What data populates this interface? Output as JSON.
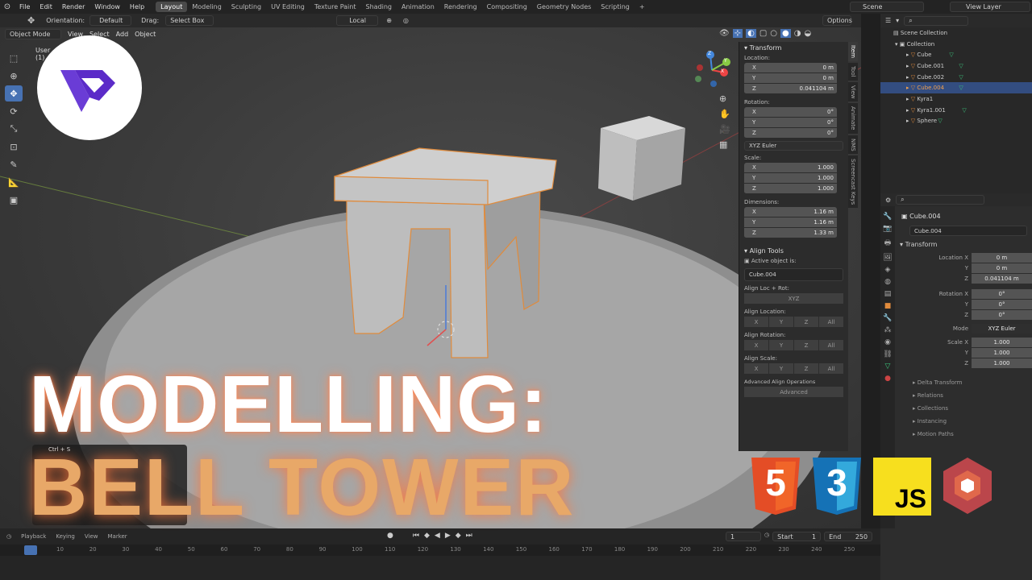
{
  "topbar": {
    "menus": [
      "File",
      "Edit",
      "Render",
      "Window",
      "Help"
    ],
    "workspaces": [
      "Layout",
      "Modeling",
      "Sculpting",
      "UV Editing",
      "Texture Paint",
      "Shading",
      "Animation",
      "Rendering",
      "Compositing",
      "Geometry Nodes",
      "Scripting"
    ],
    "active_workspace": "Layout",
    "add_tab": "+",
    "scene": "Scene",
    "view_layer": "View Layer"
  },
  "tool_header": {
    "orientation_label": "Orientation:",
    "orientation_value": "Default",
    "drag_label": "Drag:",
    "drag_value": "Select Box",
    "transform_space": "Local",
    "options": "Options"
  },
  "viewport_header": {
    "mode": "Object Mode",
    "menus": [
      "View",
      "Select",
      "Add",
      "Object"
    ],
    "overlay_text_1": "User",
    "overlay_text_2": "(1)"
  },
  "gizmo": {
    "x": "X",
    "y": "Y",
    "z": "Z"
  },
  "npanel": {
    "transform_title": "Transform",
    "location_label": "Location:",
    "location": [
      {
        "axis": "X",
        "value": "0 m"
      },
      {
        "axis": "Y",
        "value": "0 m"
      },
      {
        "axis": "Z",
        "value": "0.041104 m"
      }
    ],
    "rotation_label": "Rotation:",
    "rotation": [
      {
        "axis": "X",
        "value": "0°"
      },
      {
        "axis": "Y",
        "value": "0°"
      },
      {
        "axis": "Z",
        "value": "0°"
      }
    ],
    "rotation_mode": "XYZ Euler",
    "scale_label": "Scale:",
    "scale": [
      {
        "axis": "X",
        "value": "1.000"
      },
      {
        "axis": "Y",
        "value": "1.000"
      },
      {
        "axis": "Z",
        "value": "1.000"
      }
    ],
    "dimensions_label": "Dimensions:",
    "dimensions": [
      {
        "axis": "X",
        "value": "1.16 m"
      },
      {
        "axis": "Y",
        "value": "1.16 m"
      },
      {
        "axis": "Z",
        "value": "1.33 m"
      }
    ],
    "align_title": "Align Tools",
    "active_object_label": "Active object is:",
    "active_object": "Cube.004",
    "align_loc_rot": "Align Loc + Rot:",
    "xyz": "XYZ",
    "align_location": "Align Location:",
    "align_rotation": "Align Rotation:",
    "align_scale": "Align Scale:",
    "axis_buttons": [
      "X",
      "Y",
      "Z",
      "All"
    ],
    "advanced_ops": "Advanced Align Operations",
    "advanced": "Advanced"
  },
  "vtabs": [
    "Item",
    "Tool",
    "View",
    "Animate",
    "NMS",
    "Screencast Keys"
  ],
  "outliner": {
    "root": "Scene Collection",
    "collection": "Collection",
    "items": [
      "Cube",
      "Cube.001",
      "Cube.002",
      "Cube.004",
      "Kyra1",
      "Kyra1.001",
      "Sphere"
    ],
    "selected": "Cube.004"
  },
  "properties": {
    "object_name": "Cube.004",
    "object_field": "Cube.004",
    "transform": "Transform",
    "location_x_label": "Location X",
    "loc": [
      "0 m",
      "0 m",
      "0.041104 m"
    ],
    "rotation_x_label": "Rotation X",
    "rot": [
      "0°",
      "0°",
      "0°"
    ],
    "mode_label": "Mode",
    "mode_value": "XYZ Euler",
    "scale_x_label": "Scale X",
    "scale": [
      "1.000",
      "1.000",
      "1.000"
    ],
    "y_label": "Y",
    "z_label": "Z",
    "sections": [
      "Delta Transform",
      "Relations",
      "Collections",
      "Instancing",
      "Motion Paths"
    ]
  },
  "keystroke_overlay": "Ctrl + S",
  "timeline": {
    "menus": [
      "Playback",
      "Keying",
      "View",
      "Marker"
    ],
    "current_frame": "1",
    "start_label": "Start",
    "start": "1",
    "end_label": "End",
    "end": "250",
    "ticks": [
      "10",
      "20",
      "30",
      "40",
      "50",
      "60",
      "70",
      "80",
      "90",
      "100",
      "110",
      "120",
      "130",
      "140",
      "150",
      "160",
      "170",
      "180",
      "190",
      "200",
      "210",
      "220",
      "230",
      "240",
      "250"
    ]
  },
  "title": {
    "line1": "MODELLING:",
    "line2": "BELL TOWER"
  },
  "tech_logos": {
    "html": "5",
    "css": "3",
    "js": "JS"
  },
  "colors": {
    "accent": "#4772b3",
    "selection": "#f0a050",
    "title_orange": "#e8a868",
    "html5": "#e44d26",
    "css3": "#1572b6",
    "js": "#f7df1e",
    "babylon": "#bb464b"
  }
}
